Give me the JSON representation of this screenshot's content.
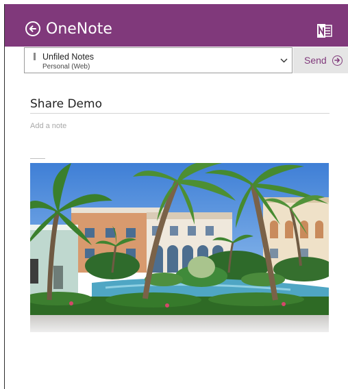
{
  "header": {
    "app_title": "OneNote",
    "back_icon": "back-arrow-icon",
    "logo_icon": "onenote-logo-icon",
    "background_color": "#80397b"
  },
  "toolbar": {
    "section_name": "Unfiled Notes",
    "notebook_name": "Personal (Web)",
    "dropdown_icon": "chevron-down-icon",
    "send_label": "Send",
    "send_icon": "arrow-right-circle-icon",
    "send_color": "#80397b"
  },
  "note": {
    "title": "Share Demo",
    "add_note_placeholder": "Add a note",
    "attachment": "resort-photo"
  }
}
